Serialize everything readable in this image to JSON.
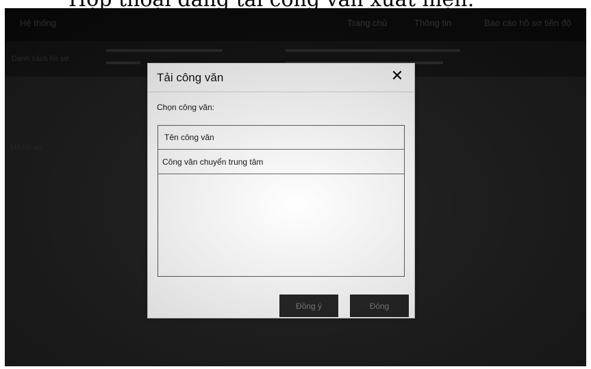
{
  "caption": {
    "text": "Hộp thoại đăng tải công văn xuất hiện:"
  },
  "top_nav": {
    "brand": "Hệ thống",
    "items": [
      "Trang chủ",
      "Thông tin",
      "Báo cáo hồ sơ tiến độ"
    ]
  },
  "sub_bar": {
    "left_label": "Danh sách hồ sơ"
  },
  "side": {
    "label": "Mã hồ sơ"
  },
  "dialog": {
    "title": "Tải công văn",
    "close_icon": "close-icon",
    "select_label": "Chọn công văn:",
    "list": {
      "header": "Tên công văn",
      "rows": [
        "Công văn chuyển trung tâm"
      ]
    },
    "buttons": {
      "ok": "Đồng ý",
      "close": "Đóng"
    }
  }
}
